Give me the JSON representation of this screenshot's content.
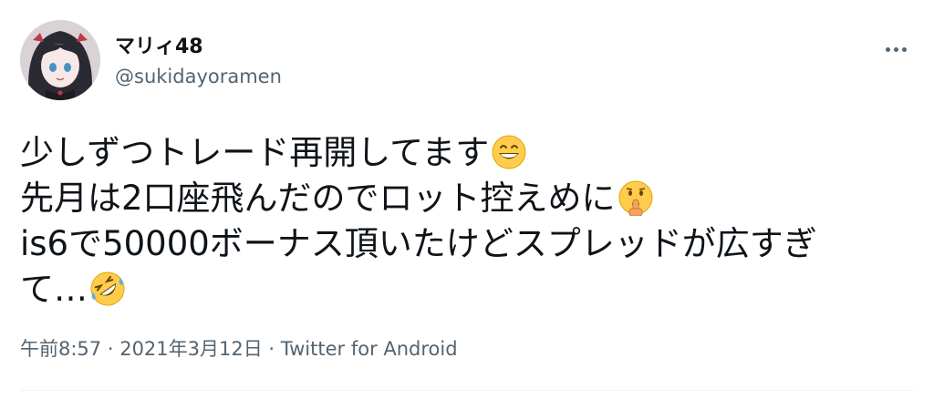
{
  "author": {
    "display_name": "マリィ48",
    "handle": "@sukidayoramen"
  },
  "tweet": {
    "lines": [
      "少しずつトレード再開してます",
      "先月は2口座飛んだのでロット控えめに",
      "is6で50000ボーナス頂いたけどスプレッドが広すぎ",
      "て…"
    ],
    "emojis": [
      "grinning-face-icon",
      "shushing-face-icon",
      "rolling-on-floor-laughing-icon"
    ]
  },
  "meta": {
    "time": "午前8:57",
    "separator": " · ",
    "date": "2021年3月12日",
    "source": "Twitter for Android"
  },
  "colors": {
    "text": "#0f1419",
    "secondary": "#536471",
    "divider": "#eff3f4"
  }
}
